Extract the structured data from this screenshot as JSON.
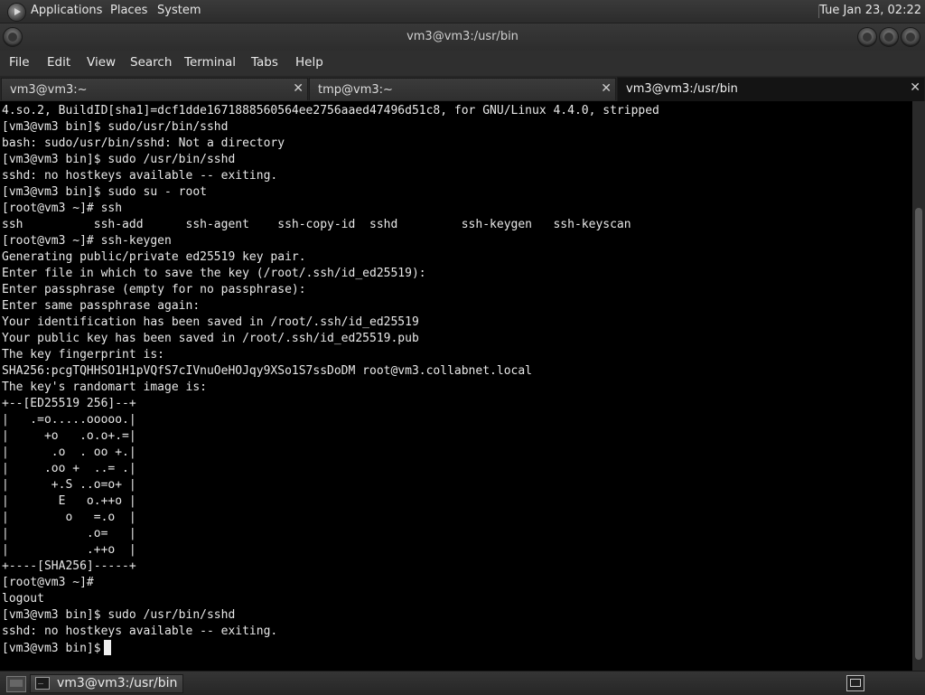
{
  "top_panel": {
    "applications": "Applications",
    "places": "Places",
    "system": "System",
    "clock": "Tue Jan 23, 02:22"
  },
  "window": {
    "title": "vm3@vm3:/usr/bin"
  },
  "menubar": {
    "file": "File",
    "edit": "Edit",
    "view": "View",
    "search": "Search",
    "terminal": "Terminal",
    "tabs": "Tabs",
    "help": "Help"
  },
  "tabs": [
    {
      "label": "vm3@vm3:~",
      "close": "✕"
    },
    {
      "label": "tmp@vm3:~",
      "close": "✕"
    },
    {
      "label": "vm3@vm3:/usr/bin",
      "close": "✕"
    }
  ],
  "terminal": {
    "lines": [
      "4.so.2, BuildID[sha1]=dcf1dde1671888560564ee2756aaed47496d51c8, for GNU/Linux 4.4.0, stripped",
      "[vm3@vm3 bin]$ sudo/usr/bin/sshd",
      "bash: sudo/usr/bin/sshd: Not a directory",
      "[vm3@vm3 bin]$ sudo /usr/bin/sshd",
      "sshd: no hostkeys available -- exiting.",
      "[vm3@vm3 bin]$ sudo su - root",
      "[root@vm3 ~]# ssh",
      "ssh          ssh-add      ssh-agent    ssh-copy-id  sshd         ssh-keygen   ssh-keyscan",
      "[root@vm3 ~]# ssh-keygen",
      "Generating public/private ed25519 key pair.",
      "Enter file in which to save the key (/root/.ssh/id_ed25519):",
      "Enter passphrase (empty for no passphrase):",
      "Enter same passphrase again:",
      "Your identification has been saved in /root/.ssh/id_ed25519",
      "Your public key has been saved in /root/.ssh/id_ed25519.pub",
      "The key fingerprint is:",
      "SHA256:pcgTQHHSO1H1pVQfS7cIVnuOeHOJqy9XSo1S7ssDoDM root@vm3.collabnet.local",
      "The key's randomart image is:",
      "+--[ED25519 256]--+",
      "|   .=o.....ooooo.|",
      "|     +o   .o.o+.=|",
      "|      .o  . oo +.|",
      "|     .oo +  ..= .|",
      "|      +.S ..o=o+ |",
      "|       E   o.++o |",
      "|        o   =.o  |",
      "|           .o=   |",
      "|           .++o  |",
      "+----[SHA256]-----+",
      "[root@vm3 ~]#",
      "logout",
      "[vm3@vm3 bin]$ sudo /usr/bin/sshd",
      "sshd: no hostkeys available -- exiting."
    ],
    "prompt": "[vm3@vm3 bin]$"
  },
  "taskbar": {
    "window_label": "vm3@vm3:/usr/bin"
  }
}
